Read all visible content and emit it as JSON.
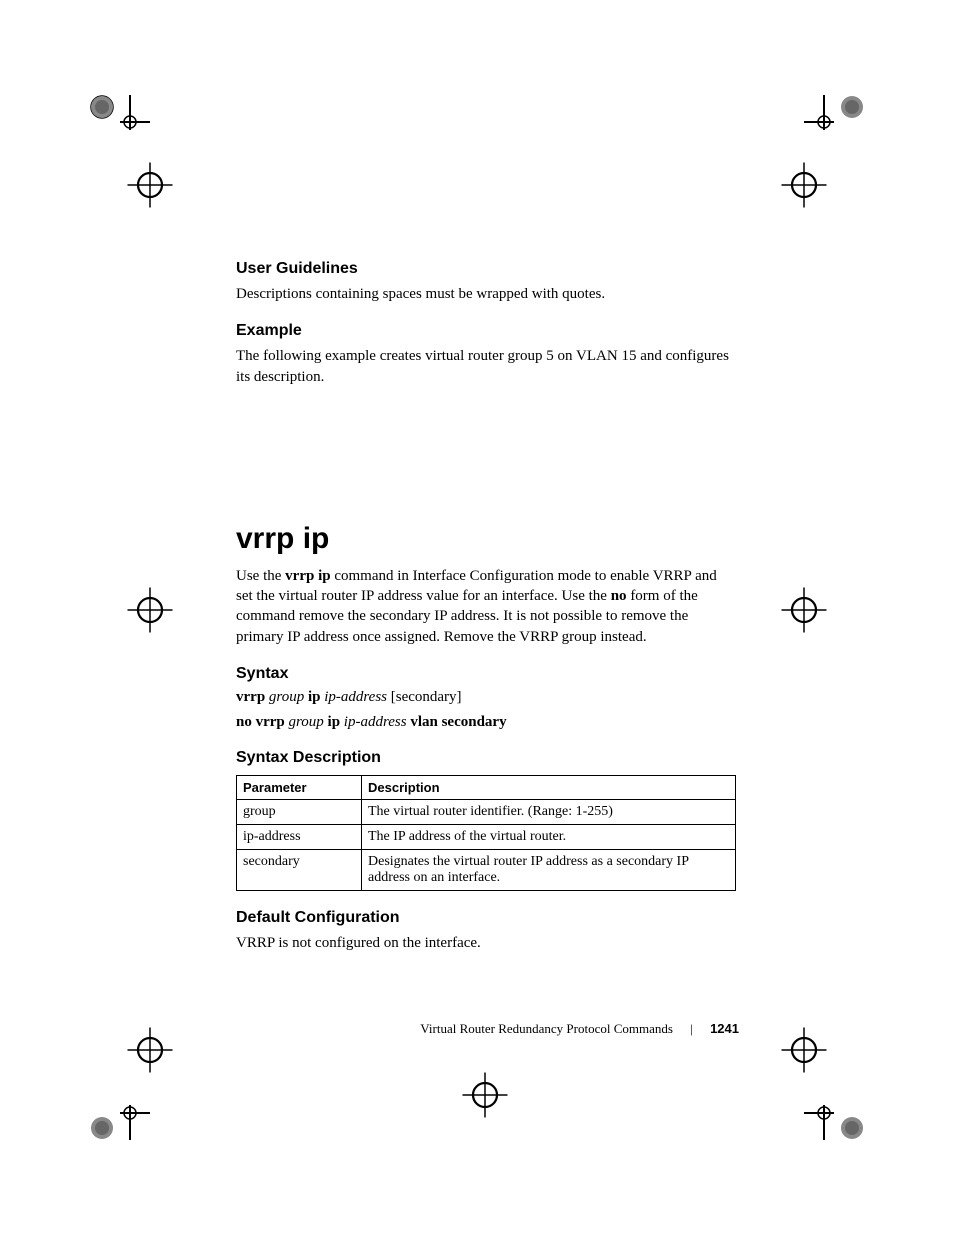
{
  "sections": {
    "user_guidelines_heading": "User Guidelines",
    "user_guidelines_text": "Descriptions containing spaces must be wrapped with quotes.",
    "example_heading": "Example",
    "example_text": "The following example creates virtual router group 5 on VLAN 15 and configures its description.",
    "command_title": "vrrp ip",
    "intro_p1": "Use the ",
    "intro_bold1": "vrrp ip",
    "intro_p2": " command in Interface Configuration mode to enable VRRP and set the virtual router IP address value for an interface. Use the ",
    "intro_bold2": "no",
    "intro_p3": " form of the command remove the secondary IP address. It is not possible to remove the primary IP address once assigned. Remove the VRRP group instead.",
    "syntax_heading": "Syntax",
    "syntax_line1": {
      "w1": "vrrp ",
      "w2": "group",
      "w3": " ip ",
      "w4": "ip-address",
      "w5": " [secondary]"
    },
    "syntax_line2": {
      "w1": "no vrrp ",
      "w2": "group",
      "w3": " ip ",
      "w4": "ip-address",
      "w5": " vlan secondary"
    },
    "syntax_desc_heading": "Syntax Description",
    "table": {
      "h1": "Parameter",
      "h2": "Description",
      "rows": [
        {
          "param": "group",
          "desc": "The virtual router identifier. (Range: 1-255)"
        },
        {
          "param": "ip-address",
          "desc": "The IP address of the virtual router."
        },
        {
          "param": "secondary",
          "desc": "Designates the virtual router IP address as a secondary IP address on an interface."
        }
      ]
    },
    "default_config_heading": "Default Configuration",
    "default_config_text": "VRRP is not configured on the interface.",
    "footer": {
      "section_name": "Virtual Router Redundancy Protocol Commands",
      "page_number": "1241"
    }
  }
}
